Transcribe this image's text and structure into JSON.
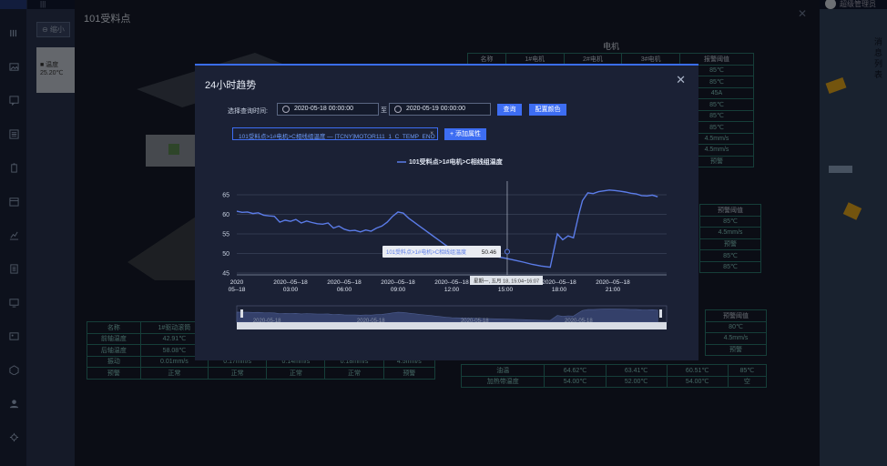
{
  "topbar": {
    "menu": "|||",
    "admin_label": "超级管理员"
  },
  "bg": {
    "zoom_btn": "⊖ 缩小",
    "card_line1": "■ 温度",
    "card_line2": "25.20℃",
    "right_vtext": "消息列表"
  },
  "panel": {
    "title": "101受料点",
    "table_title": "电机",
    "right_table": {
      "headers": [
        "名称",
        "1#电机",
        "2#电机",
        "3#电机",
        "报警阈值"
      ],
      "rows": [
        [
          "",
          "",
          "",
          "",
          "85℃"
        ],
        [
          "",
          "",
          "",
          "",
          "85℃"
        ],
        [
          "",
          "",
          "",
          "",
          "45A"
        ],
        [
          "",
          "",
          "",
          "",
          "85℃"
        ],
        [
          "",
          "",
          "",
          "",
          "85℃"
        ],
        [
          "",
          "",
          "",
          "",
          "85℃"
        ],
        [
          "",
          "",
          "",
          "",
          "4.5mm/s"
        ],
        [
          "",
          "",
          "",
          "",
          "4.5mm/s"
        ],
        [
          "",
          "",
          "",
          "",
          "预警"
        ]
      ]
    },
    "mid_table": {
      "header": "预警阈值",
      "rows": [
        "85℃",
        "4.5mm/s",
        "预警",
        "85℃",
        "85℃"
      ]
    },
    "lower_right_table": {
      "header": "预警阈值",
      "rows": [
        "80℃",
        "4.5mm/s",
        "预警"
      ]
    },
    "bottom_left_table": {
      "headers": [
        "名称",
        "1#驱动滚筒",
        "",
        "",
        "",
        ""
      ],
      "rows": [
        [
          "前轴温度",
          "42.91℃",
          "",
          "",
          "",
          ""
        ],
        [
          "后轴温度",
          "58.08℃",
          "",
          "",
          "",
          ""
        ],
        [
          "振动",
          "0.01mm/s",
          "0.17mm/s",
          "0.14mm/s",
          "0.18mm/s",
          "4.5mm/s"
        ],
        [
          "预警",
          "正常",
          "正常",
          "正常",
          "正常",
          "预警"
        ]
      ]
    },
    "bottom_right_table": {
      "rows": [
        [
          "油温",
          "64.62℃",
          "63.41℃",
          "60.51℃",
          "85℃"
        ],
        [
          "加热带温度",
          "54.00℃",
          "52.00℃",
          "54.00℃",
          "空"
        ]
      ]
    }
  },
  "modal": {
    "title": "24小时趋势",
    "query_label": "选择查询时间:",
    "start_time": "2020-05-18 00:00:00",
    "to_label": "至",
    "end_time": "2020-05-19 00:00:00",
    "query_btn": "查询",
    "color_btn": "配置颜色",
    "tag_text": "101受料点>1#电机>C相线组温度 — [TCNY]MOTOR111_1_C_TEMP_ENO",
    "tag_close": "×",
    "add_btn": "+ 添加属性",
    "tooltip_label": "101受料点>1#电机>C相线组温度",
    "tooltip_value": "50.46",
    "crosshair_label": "星期一, 五月 18, 15:04~16:07",
    "zoom_labels": [
      "2020-05-18",
      "2020-05-18",
      "2020-05-18",
      "2020-05-18"
    ]
  },
  "chart_data": {
    "type": "line",
    "title": "",
    "xlabel": "",
    "ylabel": "",
    "ylim": [
      45,
      65
    ],
    "yticks": [
      45,
      50,
      55,
      60,
      65
    ],
    "xticks": [
      {
        "h": 0,
        "l1": "2020",
        "l2": "05--18"
      },
      {
        "h": 3,
        "l1": "2020--05--18",
        "l2": "03:00"
      },
      {
        "h": 6,
        "l1": "2020--05--18",
        "l2": "06:00"
      },
      {
        "h": 9,
        "l1": "2020--05--18",
        "l2": "09:00"
      },
      {
        "h": 12,
        "l1": "2020--05--18",
        "l2": "12:00"
      },
      {
        "h": 15,
        "l1": "2020--05--18",
        "l2": "15:00"
      },
      {
        "h": 18,
        "l1": "2020--05--18",
        "l2": "18:00"
      },
      {
        "h": 21,
        "l1": "2020--05--18",
        "l2": "21:00"
      }
    ],
    "series": [
      {
        "name": "101受料点>1#电机>C相线组温度",
        "color": "#5b7ce8",
        "x": [
          0,
          0.3,
          0.6,
          0.9,
          1.2,
          1.5,
          1.8,
          2.1,
          2.4,
          2.7,
          3.0,
          3.3,
          3.6,
          3.9,
          4.2,
          4.5,
          4.8,
          5.1,
          5.4,
          5.7,
          6.0,
          6.3,
          6.6,
          6.9,
          7.2,
          7.5,
          7.8,
          8.1,
          8.4,
          8.7,
          9.0,
          9.3,
          9.6,
          9.9,
          10.2,
          10.5,
          10.8,
          11.1,
          11.4,
          11.7,
          12.0,
          12.5,
          13.0,
          13.5,
          14.0,
          14.5,
          15.0,
          15.5,
          16.0,
          16.5,
          17.0,
          17.5,
          17.9,
          18.2,
          18.5,
          18.8,
          19.1,
          19.3,
          19.6,
          19.9,
          20.2,
          20.5,
          20.8,
          21.1,
          21.4,
          21.7,
          22.0,
          22.3,
          22.6,
          22.9,
          23.2,
          23.5
        ],
        "y": [
          60.8,
          60.5,
          60.6,
          60.2,
          60.4,
          59.8,
          59.6,
          59.5,
          58.0,
          58.5,
          58.2,
          58.7,
          57.8,
          58.3,
          57.9,
          57.6,
          57.5,
          57.8,
          56.5,
          57.0,
          56.2,
          55.8,
          55.9,
          55.5,
          56.0,
          55.7,
          56.5,
          57.0,
          58.0,
          59.5,
          60.6,
          60.3,
          59.0,
          58.0,
          57.0,
          56.0,
          55.0,
          54.0,
          53.0,
          52.0,
          51.2,
          50.8,
          50.4,
          50.0,
          49.6,
          49.2,
          48.8,
          48.3,
          47.8,
          47.2,
          46.8,
          46.5,
          55.0,
          53.5,
          54.5,
          54.0,
          60.0,
          63.5,
          65.5,
          65.3,
          65.8,
          66.0,
          66.2,
          66.1,
          65.9,
          65.7,
          65.4,
          65.2,
          64.8,
          64.7,
          64.9,
          64.5
        ]
      }
    ],
    "crosshair_hour": 15.1
  }
}
